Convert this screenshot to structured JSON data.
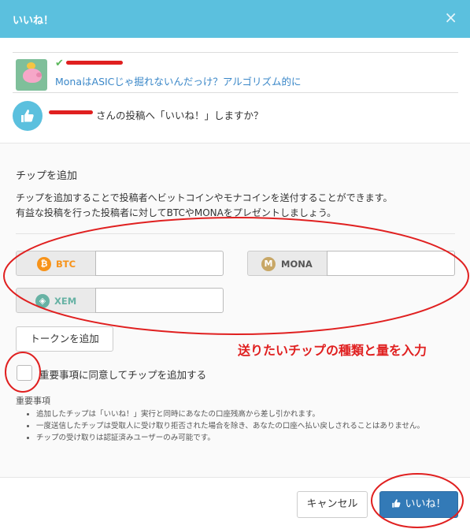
{
  "header": {
    "title": "いいね！",
    "close_label": "×"
  },
  "post": {
    "title": "MonaはASICじゃ掘れないんだっけ？アルゴリズム的に"
  },
  "question": {
    "text": "さんの投稿へ「いいね！」しますか？"
  },
  "tip": {
    "heading": "チップを追加",
    "desc_line1": "チップを追加することで投稿者へビットコインやモナコインを送付することができます。",
    "desc_line2": "有益な投稿を行った投稿者に対してBTCやMONAをプレゼントしましょう。",
    "coins": [
      {
        "symbol": "BTC",
        "icon": "bitcoin-icon",
        "color": "#f7931a",
        "value": ""
      },
      {
        "symbol": "MONA",
        "icon": "monacoin-icon",
        "color": "#c8a766",
        "value": ""
      },
      {
        "symbol": "XEM",
        "icon": "nem-icon",
        "color": "#67b2a4",
        "value": ""
      }
    ],
    "add_token_label": "トークンを追加",
    "agree_label": "重要事項に同意してチップを追加する",
    "notes_title": "重要事項",
    "notes": [
      "追加したチップは「いいね！」実行と同時にあなたの口座残高から差し引かれます。",
      "一度送信したチップは受取人に受け取り拒否された場合を除き、あなたの口座へ払い戻しされることはありません。",
      "チップの受け取りは認証済みユーザーのみ可能です。"
    ]
  },
  "annotation": {
    "text": "送りたいチップの種類と量を入力",
    "color": "#e02020"
  },
  "footer": {
    "cancel_label": "キャンセル",
    "like_label": "いいね！"
  },
  "colors": {
    "header": "#5bc0de",
    "primary": "#337ab7",
    "link": "#3a87c8"
  }
}
